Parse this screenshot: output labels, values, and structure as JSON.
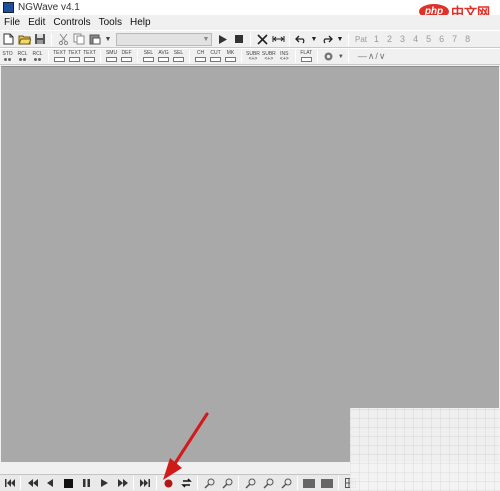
{
  "window": {
    "title": "NGWave v4.1"
  },
  "menu": [
    "File",
    "Edit",
    "Controls",
    "Tools",
    "Help"
  ],
  "toolbar": {
    "page_label": "Pat",
    "pages": [
      "1",
      "2",
      "3",
      "4",
      "5",
      "6",
      "7",
      "8"
    ],
    "row2": [
      [
        "STO",
        "B"
      ],
      [
        "RCL",
        "A"
      ],
      [
        "RCL",
        "B"
      ],
      [
        "TEXT"
      ],
      [
        "TEXT"
      ],
      [
        "TEXT"
      ],
      [
        "SMU"
      ],
      [
        "DEF"
      ],
      [
        "SEL"
      ],
      [
        "AVG"
      ],
      [
        "SEL"
      ],
      [
        "CH"
      ],
      [
        "CUT"
      ],
      [
        "MK"
      ],
      [
        "SUBR",
        "<+>"
      ],
      [
        "SUBR",
        "<+>"
      ],
      [
        "INS",
        "<+>"
      ],
      [
        "FLAT"
      ]
    ]
  },
  "watermark": {
    "logo": "php",
    "text": "中文网"
  },
  "colors": {
    "workarea": "#a9a9a9",
    "annotation_arrow": "#d11a1a",
    "record": "#b01818",
    "logo_red": "#e0302a"
  }
}
